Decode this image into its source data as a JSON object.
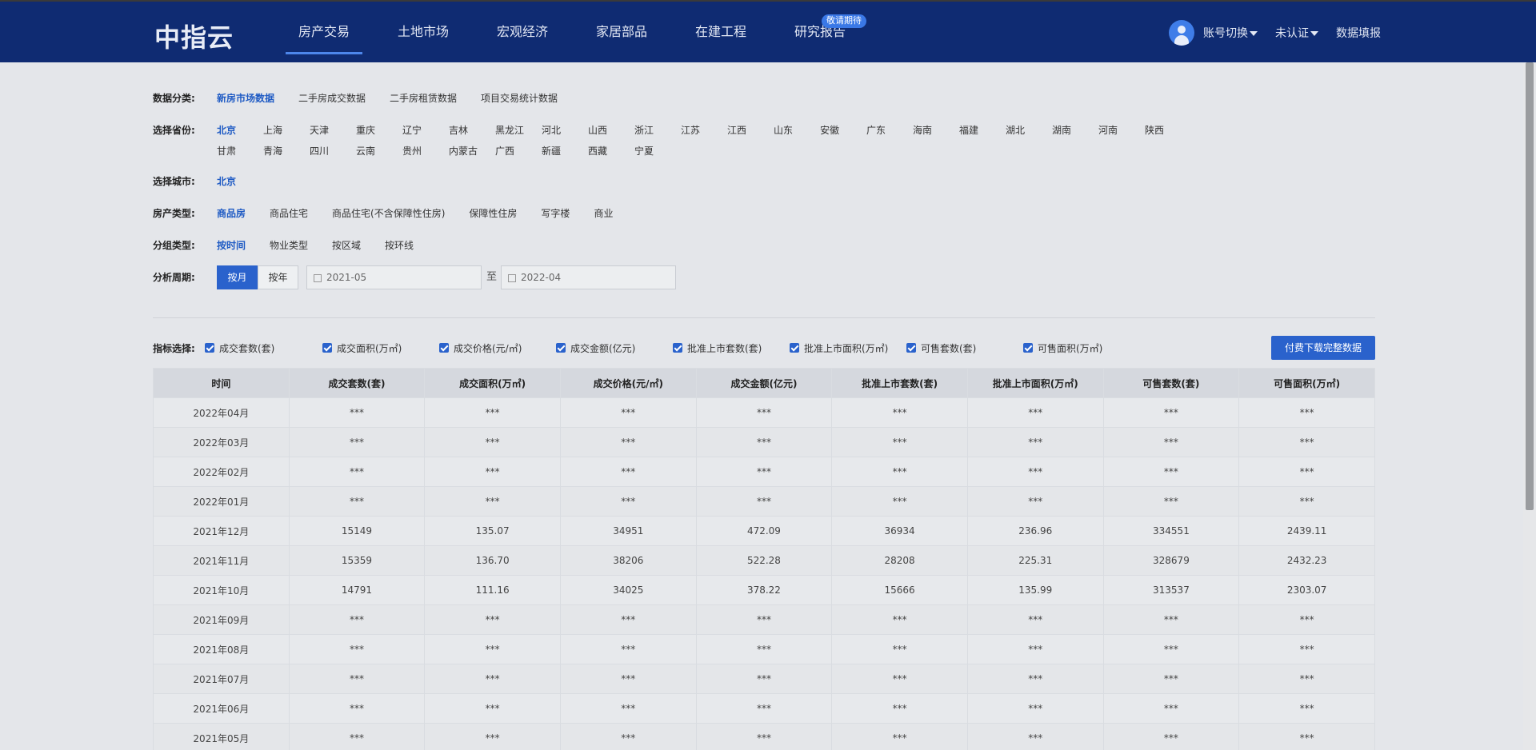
{
  "app": {
    "logo": "中指云"
  },
  "nav": [
    {
      "label": "房产交易",
      "active": true
    },
    {
      "label": "土地市场"
    },
    {
      "label": "宏观经济"
    },
    {
      "label": "家居部品"
    },
    {
      "label": "在建工程"
    },
    {
      "label": "研究报告",
      "badge": "敬请期待"
    }
  ],
  "user": {
    "switch_label": "账号切换",
    "auth_label": "未认证",
    "fill_label": "数据填报"
  },
  "filters": {
    "category": {
      "label": "数据分类:",
      "options": [
        "新房市场数据",
        "二手房成交数据",
        "二手房租赁数据",
        "项目交易统计数据"
      ]
    },
    "province": {
      "label": "选择省份:",
      "options": [
        "北京",
        "上海",
        "天津",
        "重庆",
        "辽宁",
        "吉林",
        "黑龙江",
        "河北",
        "山西",
        "浙江",
        "江苏",
        "江西",
        "山东",
        "安徽",
        "广东",
        "海南",
        "福建",
        "湖北",
        "湖南",
        "河南",
        "陕西",
        "甘肃",
        "青海",
        "四川",
        "云南",
        "贵州",
        "内蒙古",
        "广西",
        "新疆",
        "西藏",
        "宁夏"
      ]
    },
    "city": {
      "label": "选择城市:",
      "options": [
        "北京"
      ]
    },
    "property_type": {
      "label": "房产类型:",
      "options": [
        "商品房",
        "商品住宅",
        "商品住宅(不含保障性住房)",
        "保障性住房",
        "写字楼",
        "商业"
      ]
    },
    "group_type": {
      "label": "分组类型:",
      "options": [
        "按时间",
        "物业类型",
        "按区域",
        "按环线"
      ]
    },
    "period": {
      "label": "分析周期:",
      "monthly": "按月",
      "yearly": "按年",
      "start": "2021-05",
      "sep": "至",
      "end": "2022-04"
    }
  },
  "metrics": {
    "label": "指标选择:",
    "items": [
      "成交套数(套)",
      "成交面积(万㎡)",
      "成交价格(元/㎡)",
      "成交金额(亿元)",
      "批准上市套数(套)",
      "批准上市面积(万㎡)",
      "可售套数(套)",
      "可售面积(万㎡)"
    ],
    "download": "付费下载完整数据"
  },
  "table": {
    "headers": [
      "时间",
      "成交套数(套)",
      "成交面积(万㎡)",
      "成交价格(元/㎡)",
      "成交金额(亿元)",
      "批准上市套数(套)",
      "批准上市面积(万㎡)",
      "可售套数(套)",
      "可售面积(万㎡)"
    ],
    "rows": [
      [
        "2022年04月",
        "***",
        "***",
        "***",
        "***",
        "***",
        "***",
        "***",
        "***"
      ],
      [
        "2022年03月",
        "***",
        "***",
        "***",
        "***",
        "***",
        "***",
        "***",
        "***"
      ],
      [
        "2022年02月",
        "***",
        "***",
        "***",
        "***",
        "***",
        "***",
        "***",
        "***"
      ],
      [
        "2022年01月",
        "***",
        "***",
        "***",
        "***",
        "***",
        "***",
        "***",
        "***"
      ],
      [
        "2021年12月",
        "15149",
        "135.07",
        "34951",
        "472.09",
        "36934",
        "236.96",
        "334551",
        "2439.11"
      ],
      [
        "2021年11月",
        "15359",
        "136.70",
        "38206",
        "522.28",
        "28208",
        "225.31",
        "328679",
        "2432.23"
      ],
      [
        "2021年10月",
        "14791",
        "111.16",
        "34025",
        "378.22",
        "15666",
        "135.99",
        "313537",
        "2303.07"
      ],
      [
        "2021年09月",
        "***",
        "***",
        "***",
        "***",
        "***",
        "***",
        "***",
        "***"
      ],
      [
        "2021年08月",
        "***",
        "***",
        "***",
        "***",
        "***",
        "***",
        "***",
        "***"
      ],
      [
        "2021年07月",
        "***",
        "***",
        "***",
        "***",
        "***",
        "***",
        "***",
        "***"
      ],
      [
        "2021年06月",
        "***",
        "***",
        "***",
        "***",
        "***",
        "***",
        "***",
        "***"
      ],
      [
        "2021年05月",
        "***",
        "***",
        "***",
        "***",
        "***",
        "***",
        "***",
        "***"
      ]
    ]
  }
}
